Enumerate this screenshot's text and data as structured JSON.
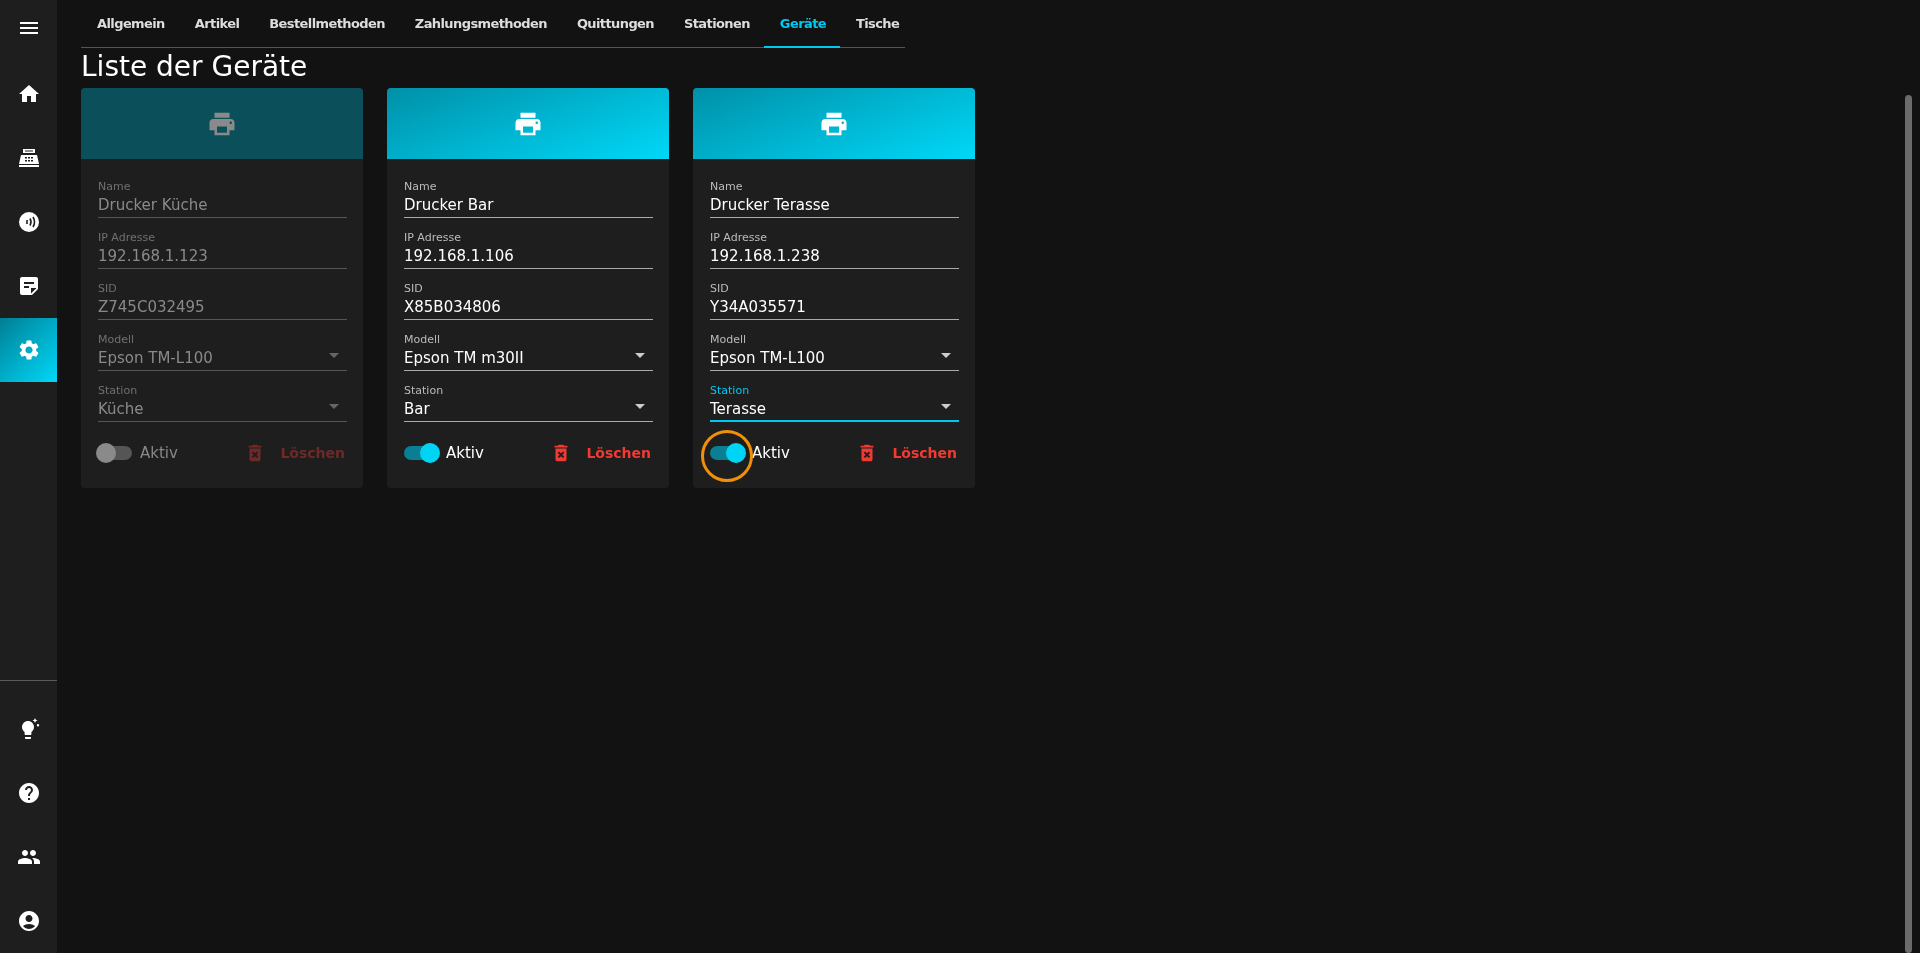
{
  "sidebar": {
    "top_items": [
      {
        "selected": false
      },
      {
        "selected": false
      },
      {
        "selected": false
      },
      {
        "selected": false
      },
      {
        "selected": true
      }
    ],
    "bottom_items": [
      {
        "selected": false
      },
      {
        "selected": false
      },
      {
        "selected": false
      },
      {
        "selected": false
      }
    ]
  },
  "tabs": [
    {
      "label": "Allgemein",
      "selected": false
    },
    {
      "label": "Artikel",
      "selected": false
    },
    {
      "label": "Bestellmethoden",
      "selected": false
    },
    {
      "label": "Zahlungsmethoden",
      "selected": false
    },
    {
      "label": "Quittungen",
      "selected": false
    },
    {
      "label": "Stationen",
      "selected": false
    },
    {
      "label": "Geräte",
      "selected": true
    },
    {
      "label": "Tische",
      "selected": false
    }
  ],
  "heading": "Liste der Geräte",
  "devices": [
    {
      "disabled": true,
      "highlighted": false,
      "fields": [
        {
          "kind": "text",
          "label": "Name",
          "value": "Drucker Küche",
          "focused": false
        },
        {
          "kind": "text",
          "label": "IP Adresse",
          "value": "192.168.1.123",
          "focused": false
        },
        {
          "kind": "text",
          "label": "SID",
          "value": "Z745C032495",
          "focused": false
        },
        {
          "kind": "select",
          "label": "Modell",
          "value": "Epson TM-L100",
          "focused": false
        },
        {
          "kind": "select",
          "label": "Station",
          "value": "Küche",
          "focused": false
        }
      ],
      "active": {
        "label": "Aktiv",
        "on": false
      },
      "delete_label": "Löschen"
    },
    {
      "disabled": false,
      "highlighted": false,
      "fields": [
        {
          "kind": "text",
          "label": "Name",
          "value": "Drucker Bar",
          "focused": false
        },
        {
          "kind": "text",
          "label": "IP Adresse",
          "value": "192.168.1.106",
          "focused": false
        },
        {
          "kind": "text",
          "label": "SID",
          "value": "X85B034806",
          "focused": false
        },
        {
          "kind": "select",
          "label": "Modell",
          "value": "Epson TM m30II",
          "focused": false
        },
        {
          "kind": "select",
          "label": "Station",
          "value": "Bar",
          "focused": false
        }
      ],
      "active": {
        "label": "Aktiv",
        "on": true
      },
      "delete_label": "Löschen"
    },
    {
      "disabled": false,
      "highlighted": true,
      "fields": [
        {
          "kind": "text",
          "label": "Name",
          "value": "Drucker Terasse",
          "focused": false
        },
        {
          "kind": "text",
          "label": "IP Adresse",
          "value": "192.168.1.238",
          "focused": false
        },
        {
          "kind": "text",
          "label": "SID",
          "value": "Y34A035571",
          "focused": false
        },
        {
          "kind": "select",
          "label": "Modell",
          "value": "Epson TM-L100",
          "focused": false
        },
        {
          "kind": "select",
          "label": "Station",
          "value": "Terasse",
          "focused": true
        }
      ],
      "active": {
        "label": "Aktiv",
        "on": true
      },
      "delete_label": "Löschen"
    }
  ]
}
